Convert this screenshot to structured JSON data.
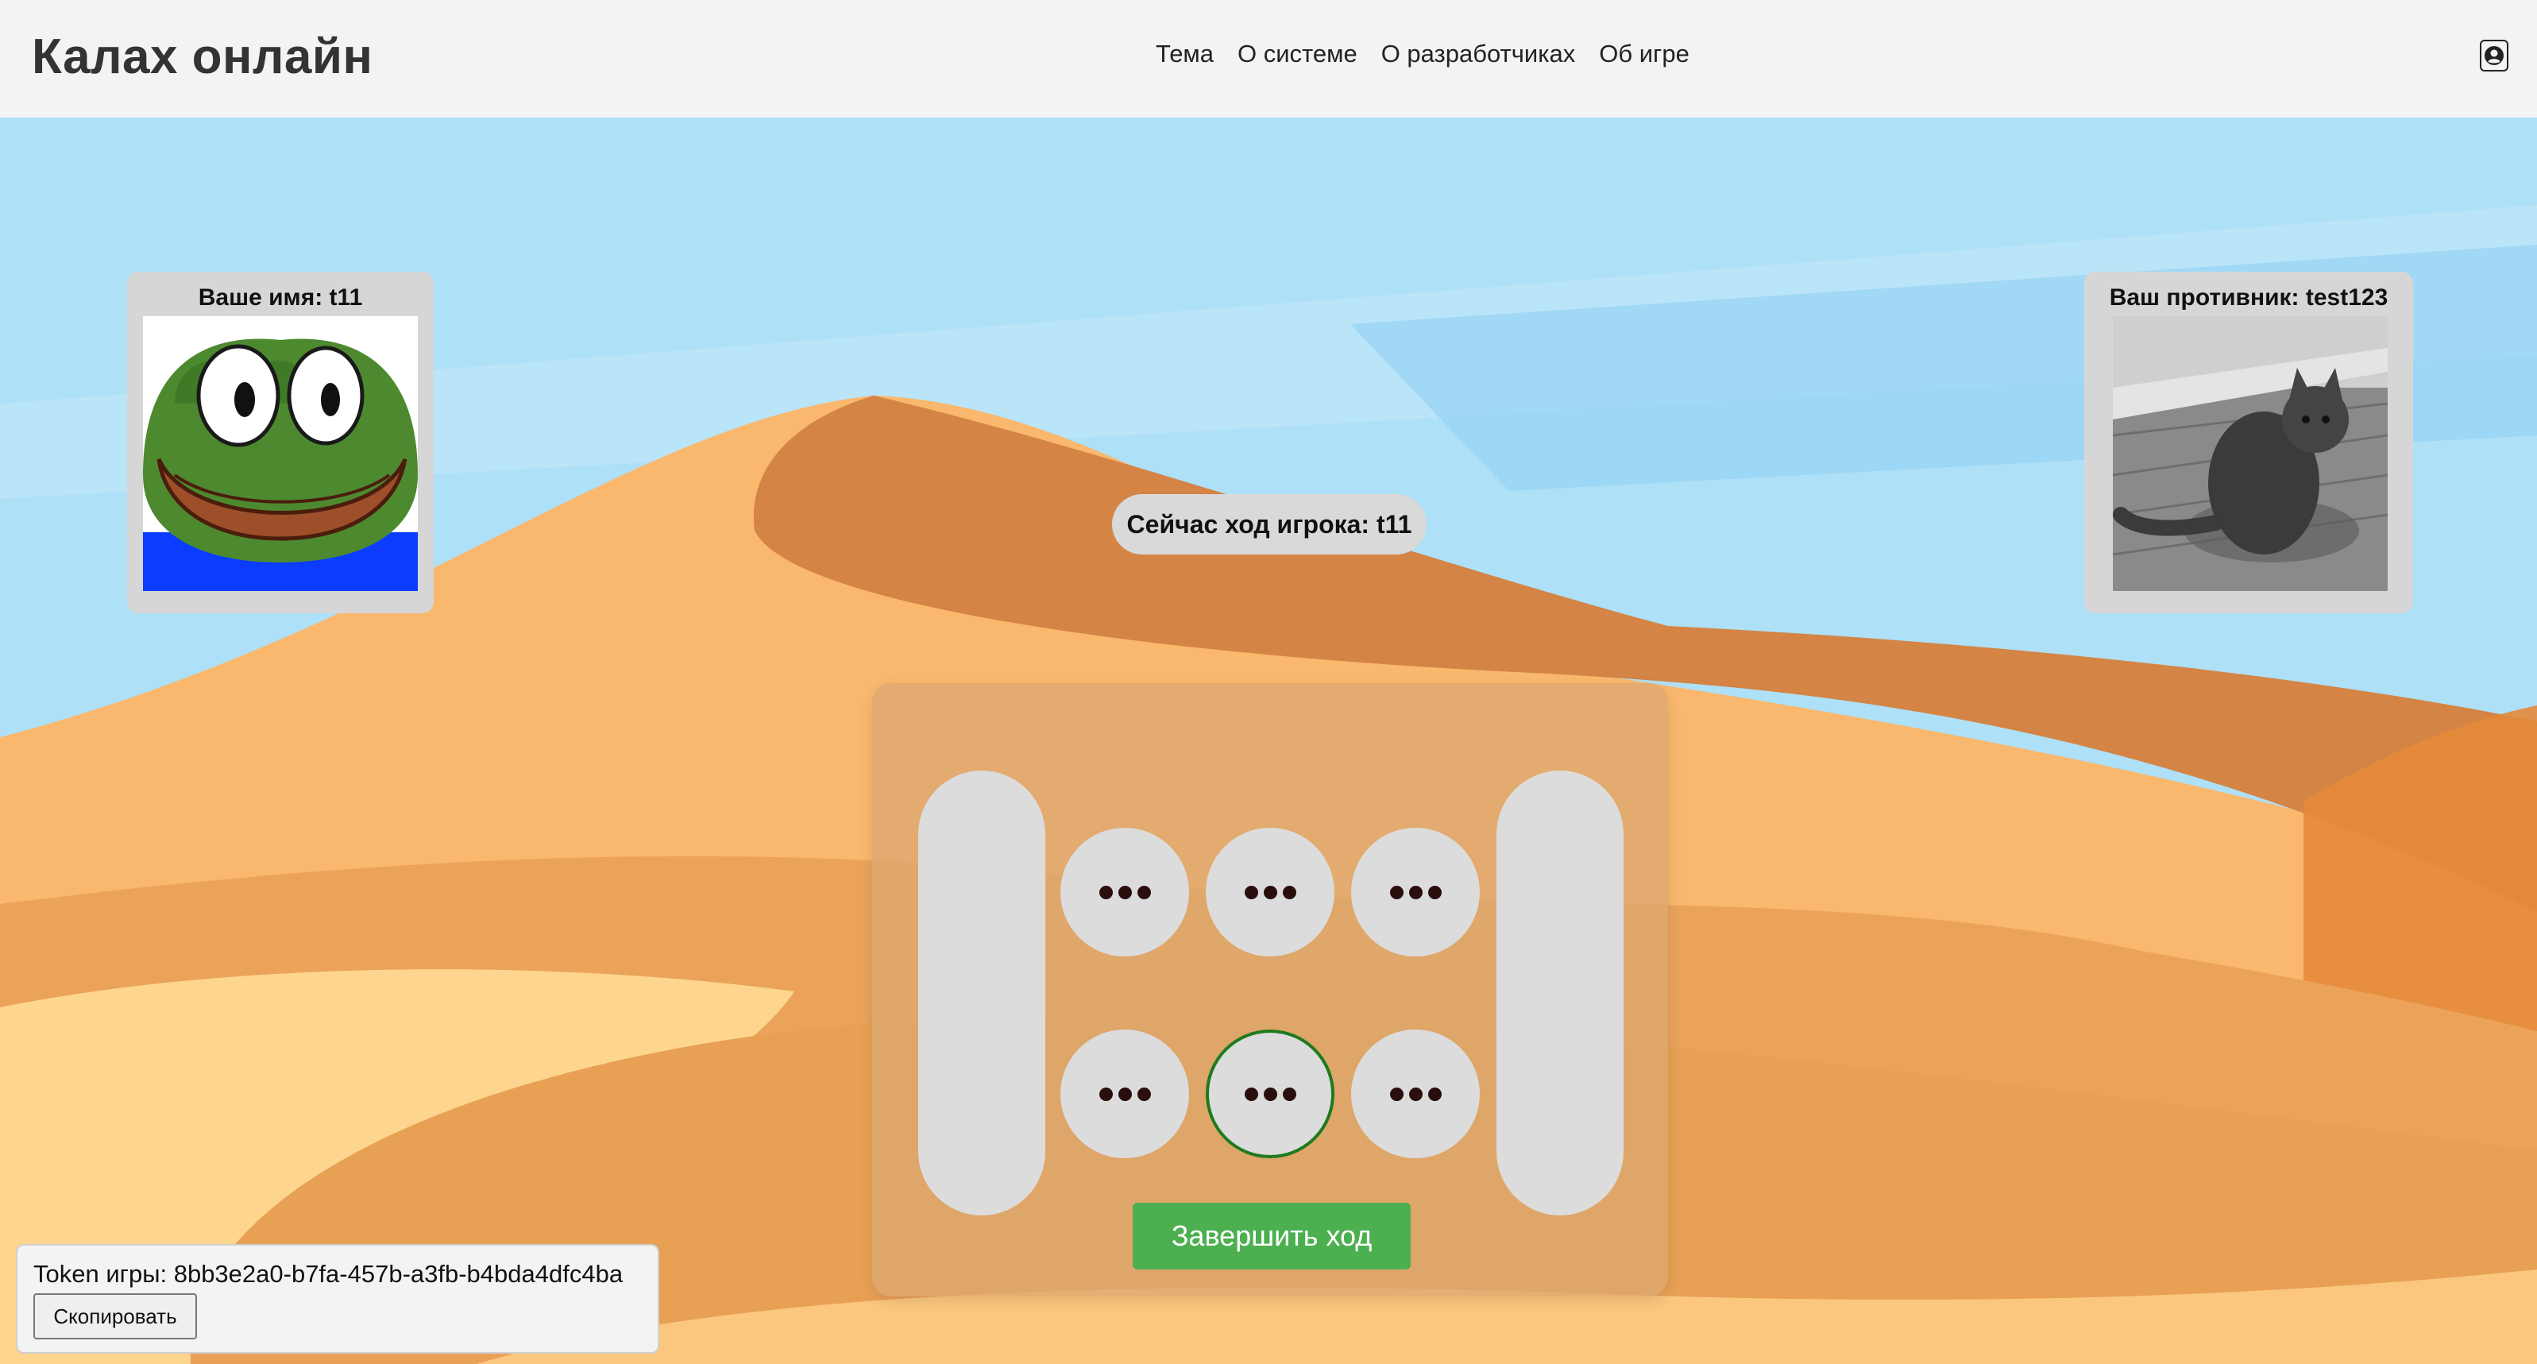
{
  "app": {
    "title": "Калах онлайн",
    "nav": [
      "Тема",
      "О системе",
      "О разработчиках",
      "Об игре"
    ],
    "profile_icon": "user-circle-icon"
  },
  "players": {
    "me_label": "Ваше имя: t11",
    "opponent_label": "Ваш противник: test123"
  },
  "turn_text": "Сейчас ход игрока: t11",
  "board": {
    "pit_icon": "ellipsis-icon",
    "selected_pit": "bottom-2",
    "end_turn_label": "Завершить ход"
  },
  "token": {
    "text": "Token игры: 8bb3e2a0-b7fa-457b-a3fb-b4bda4dfc4ba",
    "copy_label": "Скопировать"
  },
  "colors": {
    "sky": "#aee0f7",
    "dune_dark": "#d48444",
    "dune_light": "#f9b86d",
    "board": "#dca870",
    "end_button": "#4caf50",
    "selected_pit_border": "#1f7a1f"
  }
}
